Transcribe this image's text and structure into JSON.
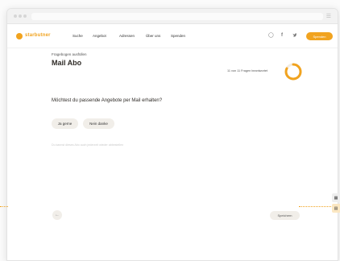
{
  "nav": {
    "brand": "starbutner",
    "items": [
      "Suche",
      "Angebot",
      "Adressen",
      "Über uns",
      "Spenden"
    ],
    "icons": [
      "user-icon",
      "facebook-icon",
      "twitter-icon"
    ],
    "donate_label": "Spenden",
    "accent": "#f1a31f"
  },
  "step": {
    "subtitle": "Fragebogen ausfüllen",
    "title": "Mail Abo",
    "progress_text": "11 von 11 Fragen beantwortet",
    "progress_fraction": 0.82
  },
  "question": {
    "text": "Möchtest du passende Angebote per Mail erhalten?",
    "answers": [
      "Ja gerne",
      "Nein danke"
    ],
    "note": "Du kannst dieses Abo auch jederzeit wieder abbestellen"
  },
  "footer": {
    "back_label": "←",
    "save_label": "Speichern"
  }
}
